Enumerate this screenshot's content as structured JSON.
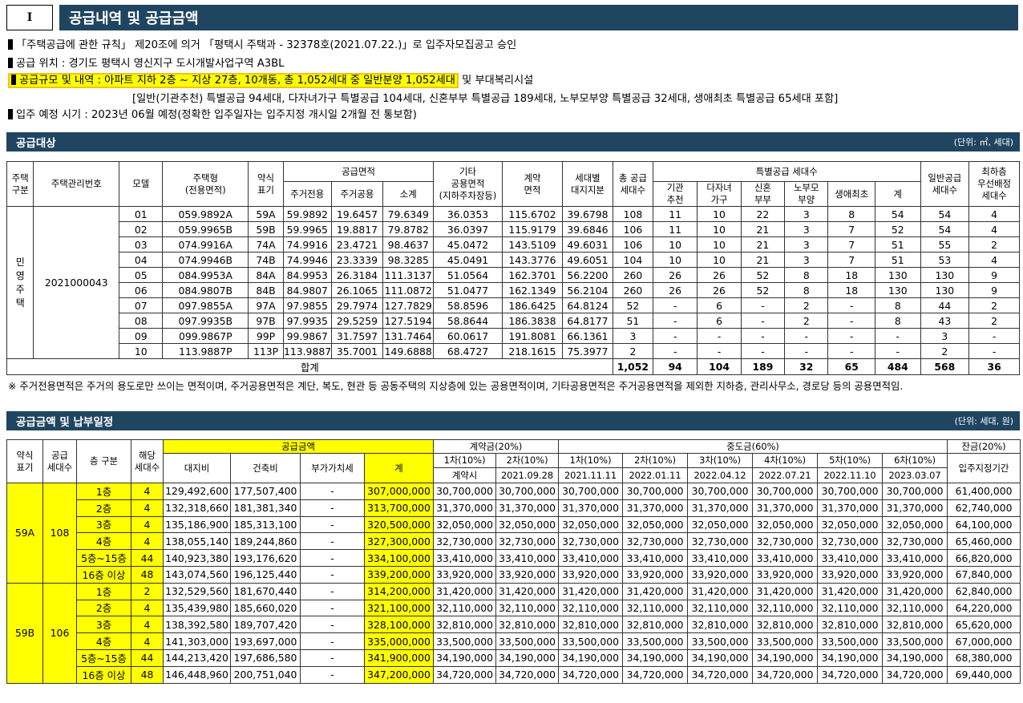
{
  "section": {
    "roman": "Ⅰ",
    "title": "공급내역 및 공급금액"
  },
  "info": {
    "line1": "「주택공급에 관한 규칙」 제20조에 의거 「평택시 주택과 - 32378호(2021.07.22.)」로 입주자모집공고 승인",
    "line2": "공급 위치 : 경기도 평택시 영신지구 도시개발사업구역 A3BL",
    "line3_hl": "공급규모 및 내역 : 아파트 지하 2층 ~ 지상 27층, 10개동, 총 1,052세대 중 일반분양 1,052세대",
    "line3_rest": " 및 부대복리시설",
    "line4": "[일반(기관추천) 특별공급 94세대, 다자녀가구 특별공급 104세대, 신혼부부 특별공급 189세대, 노부모부양 특별공급 32세대, 생애최초 특별공급 65세대 포함]",
    "line5": "입주 예정 시기 : 2023년 06월 예정(정확한 입주일자는 입주지정 개시일 2개월 전 통보함)"
  },
  "supply_target": {
    "title": "공급대상",
    "unit": "(단위: ㎡, 세대)",
    "h": {
      "house_type": "주택\n구분",
      "mgmt_no": "주택관리번호",
      "model": "모델",
      "house_kind": "주택형\n(전용면적)",
      "abbr": "약식\n표기",
      "supply_area": "공급면적",
      "residential": "주거전용",
      "common": "주거공용",
      "subtotal": "소계",
      "other": "기타\n공용면적\n(지하주차장등)",
      "contract": "계약\n면적",
      "land": "세대별\n대지지분",
      "total_supply": "총 공급\n세대수",
      "special": "특별공급 세대수",
      "inst": "기관\n추천",
      "multi": "다자녀\n가구",
      "newly": "신혼\n부부",
      "elder": "노부모\n부양",
      "first": "생애최초",
      "sum": "계",
      "general": "일반공급\n세대수",
      "lowest": "최하층\n우선배정\n세대수"
    },
    "house_type_val": "민\n영\n주\n택",
    "mgmt_no_val": "2021000043",
    "rows": [
      [
        "01",
        "059.9892A",
        "59A",
        "59.9892",
        "19.6457",
        "79.6349",
        "36.0353",
        "115.6702",
        "39.6798",
        "108",
        "11",
        "10",
        "22",
        "3",
        "8",
        "54",
        "54",
        "4"
      ],
      [
        "02",
        "059.9965B",
        "59B",
        "59.9965",
        "19.8817",
        "79.8782",
        "36.0397",
        "115.9179",
        "39.6846",
        "106",
        "11",
        "10",
        "21",
        "3",
        "7",
        "52",
        "54",
        "4"
      ],
      [
        "03",
        "074.9916A",
        "74A",
        "74.9916",
        "23.4721",
        "98.4637",
        "45.0472",
        "143.5109",
        "49.6031",
        "106",
        "10",
        "10",
        "21",
        "3",
        "7",
        "51",
        "55",
        "2"
      ],
      [
        "04",
        "074.9946B",
        "74B",
        "74.9946",
        "23.3339",
        "98.3285",
        "45.0491",
        "143.3776",
        "49.6051",
        "104",
        "10",
        "10",
        "21",
        "3",
        "7",
        "51",
        "53",
        "4"
      ],
      [
        "05",
        "084.9953A",
        "84A",
        "84.9953",
        "26.3184",
        "111.3137",
        "51.0564",
        "162.3701",
        "56.2200",
        "260",
        "26",
        "26",
        "52",
        "8",
        "18",
        "130",
        "130",
        "9"
      ],
      [
        "06",
        "084.9807B",
        "84B",
        "84.9807",
        "26.1065",
        "111.0872",
        "51.0477",
        "162.1349",
        "56.2104",
        "260",
        "26",
        "26",
        "52",
        "8",
        "18",
        "130",
        "130",
        "9"
      ],
      [
        "07",
        "097.9855A",
        "97A",
        "97.9855",
        "29.7974",
        "127.7829",
        "58.8596",
        "186.6425",
        "64.8124",
        "52",
        "-",
        "6",
        "-",
        "2",
        "-",
        "8",
        "44",
        "2"
      ],
      [
        "08",
        "097.9935B",
        "97B",
        "97.9935",
        "29.5259",
        "127.5194",
        "58.8644",
        "186.3838",
        "64.8177",
        "51",
        "-",
        "6",
        "-",
        "2",
        "-",
        "8",
        "43",
        "2"
      ],
      [
        "09",
        "099.9867P",
        "99P",
        "99.9867",
        "31.7597",
        "131.7464",
        "60.0617",
        "191.8081",
        "66.1361",
        "3",
        "-",
        "-",
        "-",
        "-",
        "-",
        "-",
        "3",
        "-"
      ],
      [
        "10",
        "113.9887P",
        "113P",
        "113.9887",
        "35.7001",
        "149.6888",
        "68.4727",
        "218.1615",
        "75.3977",
        "2",
        "-",
        "-",
        "-",
        "-",
        "-",
        "-",
        "2",
        "-"
      ]
    ],
    "total": {
      "label": "합계",
      "vals": [
        "1,052",
        "94",
        "104",
        "189",
        "32",
        "65",
        "484",
        "568",
        "36"
      ]
    }
  },
  "note": "※ 주거전용면적은 주거의 용도로만 쓰이는 면적이며, 주거공용면적은 계단, 복도, 현관 등 공동주택의 지상층에 있는 공용면적이며, 기타공용면적은 주거공용면적을 제외한 지하층, 관리사무소, 경로당 등의 공용면적임.",
  "price": {
    "title": "공급금액 및 납부일정",
    "unit": "(단위: 세대, 원)",
    "h": {
      "abbr": "약식\n표기",
      "supply_cnt": "공급\n세대수",
      "floor": "층 구분",
      "count": "해당\n세대수",
      "amount": "공급금액",
      "land": "대지비",
      "build": "건축비",
      "vat": "부가가치세",
      "sum": "계",
      "contract": "계약금(20%)",
      "mid": "중도금(60%)",
      "balance": "잔금(20%)",
      "c1": "1차(10%)",
      "c2": "2차(10%)",
      "c1d": "계약시",
      "c2d": "2021.09.28",
      "m1": "1차(10%)",
      "m2": "2차(10%)",
      "m3": "3차(10%)",
      "m4": "4차(10%)",
      "m5": "5차(10%)",
      "m6": "6차(10%)",
      "m1d": "2021.11.11",
      "m2d": "2022.01.11",
      "m3d": "2022.04.12",
      "m4d": "2022.07.21",
      "m5d": "2022.11.10",
      "m6d": "2023.03.07",
      "bal": "입주지정기간"
    },
    "groups": [
      {
        "abbr": "59A",
        "cnt": "108",
        "rows": [
          [
            "1층",
            "4",
            "129,492,600",
            "177,507,400",
            "-",
            "307,000,000",
            "30,700,000",
            "30,700,000",
            "30,700,000",
            "30,700,000",
            "30,700,000",
            "30,700,000",
            "30,700,000",
            "30,700,000",
            "61,400,000"
          ],
          [
            "2층",
            "4",
            "132,318,660",
            "181,381,340",
            "-",
            "313,700,000",
            "31,370,000",
            "31,370,000",
            "31,370,000",
            "31,370,000",
            "31,370,000",
            "31,370,000",
            "31,370,000",
            "31,370,000",
            "62,740,000"
          ],
          [
            "3층",
            "4",
            "135,186,900",
            "185,313,100",
            "-",
            "320,500,000",
            "32,050,000",
            "32,050,000",
            "32,050,000",
            "32,050,000",
            "32,050,000",
            "32,050,000",
            "32,050,000",
            "32,050,000",
            "64,100,000"
          ],
          [
            "4층",
            "4",
            "138,055,140",
            "189,244,860",
            "-",
            "327,300,000",
            "32,730,000",
            "32,730,000",
            "32,730,000",
            "32,730,000",
            "32,730,000",
            "32,730,000",
            "32,730,000",
            "32,730,000",
            "65,460,000"
          ],
          [
            "5층~15층",
            "44",
            "140,923,380",
            "193,176,620",
            "-",
            "334,100,000",
            "33,410,000",
            "33,410,000",
            "33,410,000",
            "33,410,000",
            "33,410,000",
            "33,410,000",
            "33,410,000",
            "33,410,000",
            "66,820,000"
          ],
          [
            "16층 이상",
            "48",
            "143,074,560",
            "196,125,440",
            "-",
            "339,200,000",
            "33,920,000",
            "33,920,000",
            "33,920,000",
            "33,920,000",
            "33,920,000",
            "33,920,000",
            "33,920,000",
            "33,920,000",
            "67,840,000"
          ]
        ]
      },
      {
        "abbr": "59B",
        "cnt": "106",
        "rows": [
          [
            "1층",
            "2",
            "132,529,560",
            "181,670,440",
            "-",
            "314,200,000",
            "31,420,000",
            "31,420,000",
            "31,420,000",
            "31,420,000",
            "31,420,000",
            "31,420,000",
            "31,420,000",
            "31,420,000",
            "62,840,000"
          ],
          [
            "2층",
            "4",
            "135,439,980",
            "185,660,020",
            "-",
            "321,100,000",
            "32,110,000",
            "32,110,000",
            "32,110,000",
            "32,110,000",
            "32,110,000",
            "32,110,000",
            "32,110,000",
            "32,110,000",
            "64,220,000"
          ],
          [
            "3층",
            "4",
            "138,392,580",
            "189,707,420",
            "-",
            "328,100,000",
            "32,810,000",
            "32,810,000",
            "32,810,000",
            "32,810,000",
            "32,810,000",
            "32,810,000",
            "32,810,000",
            "32,810,000",
            "65,620,000"
          ],
          [
            "4층",
            "4",
            "141,303,000",
            "193,697,000",
            "-",
            "335,000,000",
            "33,500,000",
            "33,500,000",
            "33,500,000",
            "33,500,000",
            "33,500,000",
            "33,500,000",
            "33,500,000",
            "33,500,000",
            "67,000,000"
          ],
          [
            "5층~15층",
            "44",
            "144,213,420",
            "197,686,580",
            "-",
            "341,900,000",
            "34,190,000",
            "34,190,000",
            "34,190,000",
            "34,190,000",
            "34,190,000",
            "34,190,000",
            "34,190,000",
            "34,190,000",
            "68,380,000"
          ],
          [
            "16층 이상",
            "48",
            "146,448,960",
            "200,751,040",
            "-",
            "347,200,000",
            "34,720,000",
            "34,720,000",
            "34,720,000",
            "34,720,000",
            "34,720,000",
            "34,720,000",
            "34,720,000",
            "34,720,000",
            "69,440,000"
          ]
        ]
      }
    ]
  }
}
